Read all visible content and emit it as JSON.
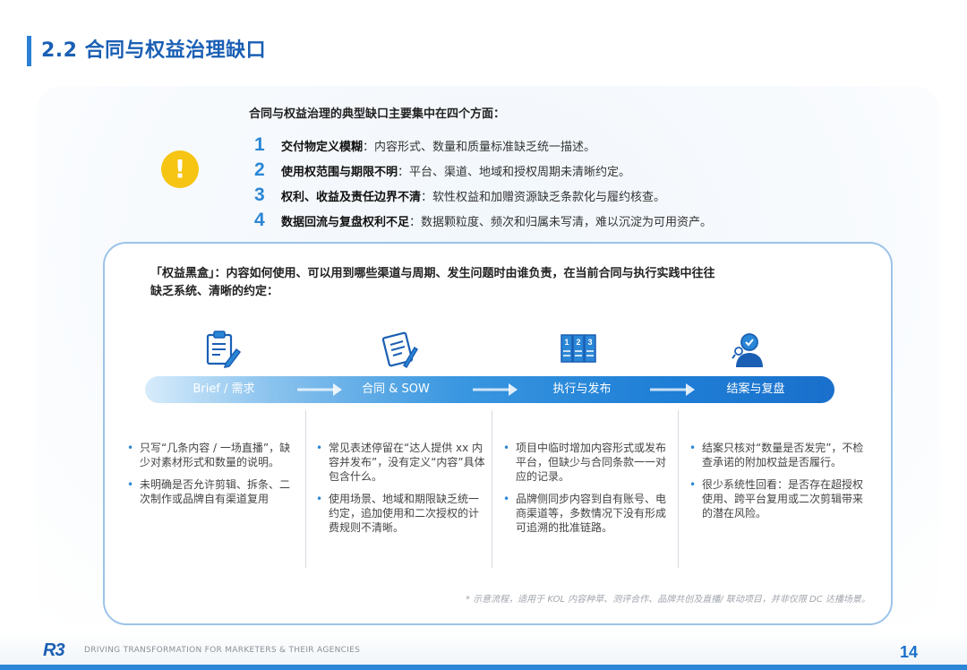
{
  "header": {
    "title": "2.2 合同与权益治理缺口"
  },
  "intro": "合同与权益治理的典型缺口主要集中在四个方面：",
  "alert_icon": "exclamation-icon",
  "points": [
    {
      "num": "1",
      "bold": "交付物定义模糊",
      "text": "：内容形式、数量和质量标准缺乏统一描述。"
    },
    {
      "num": "2",
      "bold": "使用权范围与期限不明",
      "text": "：平台、渠道、地域和授权周期未清晰约定。"
    },
    {
      "num": "3",
      "bold": "权利、收益及责任边界不清",
      "text": "：软性权益和加赠资源缺乏条款化与履约核查。"
    },
    {
      "num": "4",
      "bold": "数据回流与复盘权利不足",
      "text": "：数据颗粒度、频次和归属未写清，难以沉淀为可用资产。"
    }
  ],
  "card": {
    "head_line1": "「权益黑盒」：内容如何使用、可以用到哪些渠道与周期、发生问题时由谁负责，在当前合同与执行实践中往往",
    "head_line2": "缺乏系统、清晰的约定："
  },
  "stages": [
    {
      "icon": "clipboard-pen-icon",
      "label": "Brief / 需求",
      "bullets": [
        "只写“几条内容 / 一场直播”，缺少对素材形式和数量的说明。",
        "未明确是否允许剪辑、拆条、二次制作或品牌自有渠道复用"
      ]
    },
    {
      "icon": "contract-sign-icon",
      "label": "合同 & SOW",
      "bullets": [
        "常见表述停留在“达人提供 xx 内容并发布”，没有定义“内容”具体包含什么。",
        "使用场景、地域和期限缺乏统一约定，追加使用和二次授权的计费规则不清晰。"
      ]
    },
    {
      "icon": "numbered-steps-icon",
      "label": "执行与发布",
      "bullets": [
        "项目中临时增加内容形式或发布平台，但缺少与合同条款一一对应的记录。",
        "品牌侧同步内容到自有账号、电商渠道等，多数情况下没有形成可追溯的批准链路。"
      ]
    },
    {
      "icon": "review-person-icon",
      "label": "结案与复盘",
      "bullets": [
        "结案只核对“数量是否发完”，不检查承诺的附加权益是否履行。",
        "很少系统性回看：是否存在超授权使用、跨平台复用或二次剪辑带来的潜在风险。"
      ]
    }
  ],
  "footnote": "* 示意流程，适用于 KOL 内容种草、测评合作、品牌共创及直播/ 联动项目，并非仅限 DC 达播场景。",
  "footer": {
    "logo": "R3",
    "tagline": "DRIVING TRANSFORMATION FOR MARKETERS & THEIR AGENCIES",
    "page": "14"
  },
  "colors": {
    "accent": "#2a86d6",
    "title": "#1a5fb4",
    "alert": "#f6c413"
  }
}
